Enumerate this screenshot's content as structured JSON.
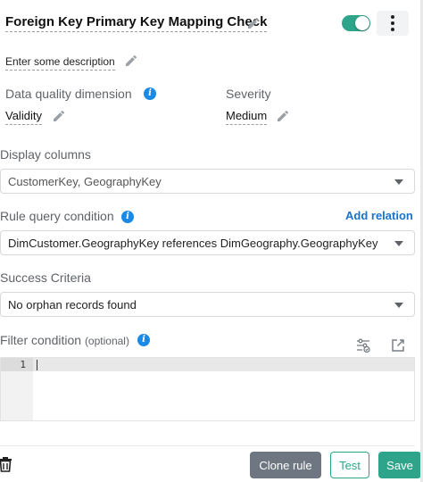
{
  "header": {
    "title": "Foreign Key Primary Key Mapping Check",
    "enabled": true,
    "icons": {
      "edit": "pencil-icon",
      "more": "vertical-dots-icon"
    }
  },
  "description": {
    "placeholder": "Enter some description"
  },
  "data_quality_dimension": {
    "label": "Data quality dimension",
    "value": "Validity"
  },
  "severity": {
    "label": "Severity",
    "value": "Medium"
  },
  "display_columns": {
    "label": "Display columns",
    "value": "CustomerKey, GeographyKey"
  },
  "rule_query_condition": {
    "label": "Rule query condition",
    "add_relation_label": "Add relation",
    "value": "DimCustomer.GeographyKey references DimGeography.GeographyKey"
  },
  "success_criteria": {
    "label": "Success Criteria",
    "value": "No orphan records found"
  },
  "filter_condition": {
    "label": "Filter condition",
    "optional_label": "(optional)",
    "line_number": "1",
    "content": "",
    "icons": {
      "settings": "filter-settings-icon",
      "expand": "expand-icon"
    }
  },
  "footer": {
    "clone_label": "Clone rule",
    "test_label": "Test",
    "save_label": "Save",
    "icons": {
      "delete": "trash-icon"
    }
  },
  "colors": {
    "accent": "#2ea58a",
    "link": "#1a73c8",
    "info": "#1a8ae6",
    "clone_button": "#6e7781"
  }
}
